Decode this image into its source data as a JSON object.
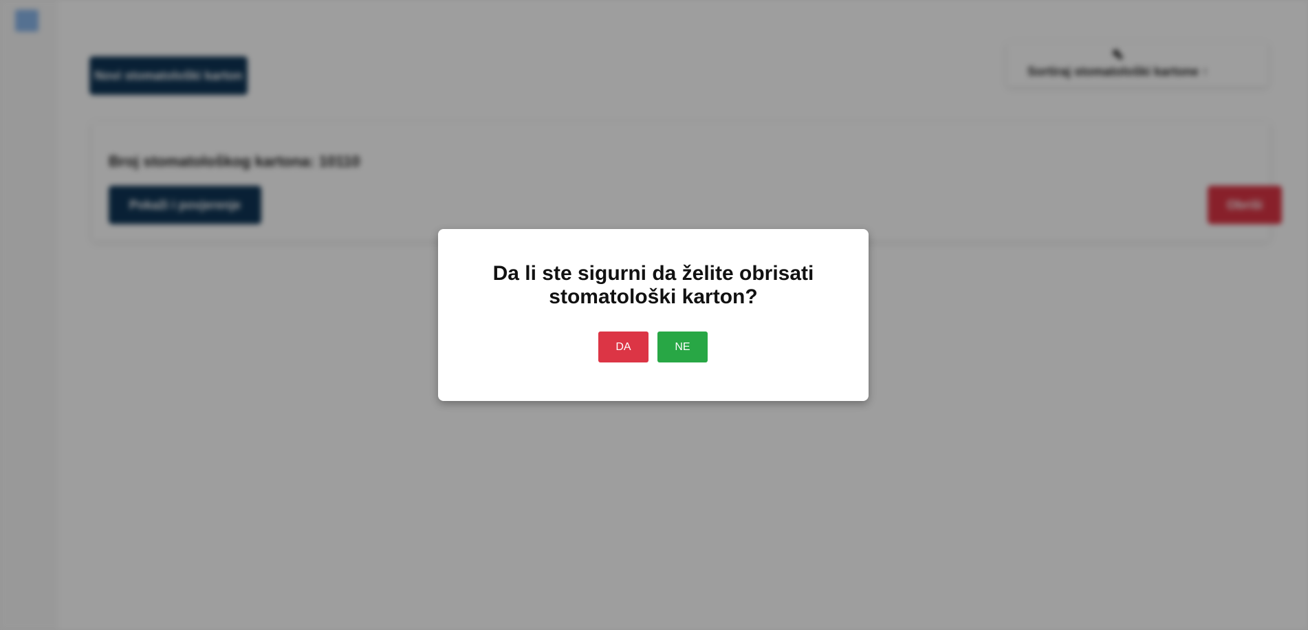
{
  "background": {
    "new_card_button": "Novi stomatološki karton",
    "sort_label": "Sortiraj stomatološki kartone ↑",
    "card": {
      "number_label": "Broj stomatološkog kartona: 10110",
      "show_button": "Pokaži i povjerenje",
      "delete_button": "Obriši"
    }
  },
  "dialog": {
    "title_line1": "Da li ste sigurni da želite obrisati",
    "title_line2": "stomatološki karton?",
    "yes_label": "DA",
    "no_label": "NE"
  },
  "colors": {
    "primary_dark": "#0f3556",
    "danger": "#dc3545",
    "success": "#28a745",
    "logo": "#8ab6ea"
  }
}
